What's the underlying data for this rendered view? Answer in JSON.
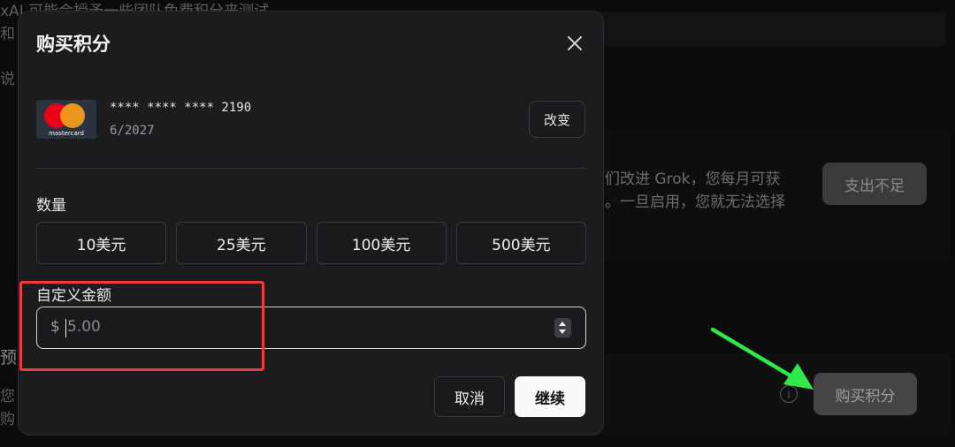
{
  "background": {
    "top_text_1": "xAI 可能会授予一些团队免费积分来测试",
    "top_text_2": "和",
    "side_text": "说",
    "grok_line_1": "们改进 Grok，您每月可获",
    "grok_line_2": "。一旦启用，您就无法选择",
    "spend_button": "支出不足",
    "prepay_text": "预",
    "left_lines": [
      "您",
      "购"
    ],
    "buy_credits_button": "购买积分"
  },
  "modal": {
    "title": "购买积分",
    "card": {
      "brand": "mastercard",
      "number": "**** **** **** 2190",
      "expiry": "6/2027",
      "change_label": "改变"
    },
    "quantity_label": "数量",
    "amounts": [
      "10美元",
      "25美元",
      "100美元",
      "500美元"
    ],
    "custom_label": "自定义金额",
    "currency_symbol": "$",
    "custom_placeholder": "5.00",
    "cancel_label": "取消",
    "continue_label": "继续"
  },
  "colors": {
    "annotation_box": "#ef3b3b",
    "annotation_arrow": "#2fe84a",
    "mastercard_red": "#eb001b",
    "mastercard_orange": "#f79e1b"
  }
}
